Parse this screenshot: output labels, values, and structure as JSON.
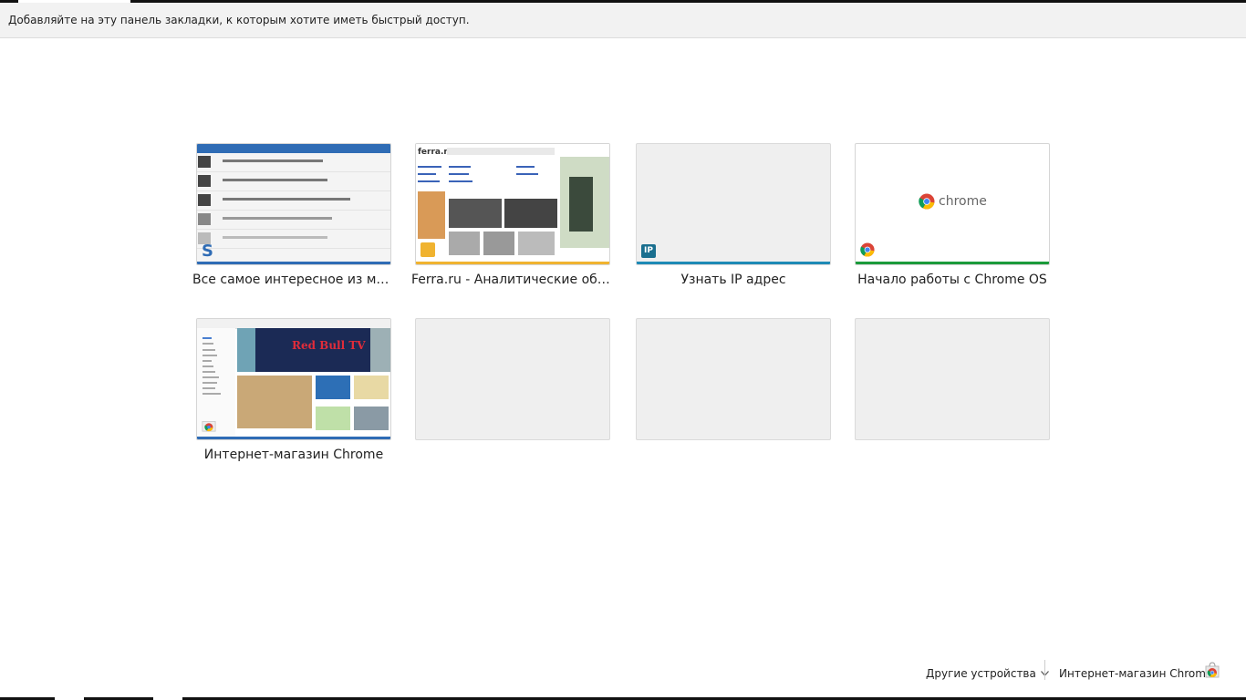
{
  "bookmarks_bar": {
    "hint": "Добавляйте на эту панель закладки, к которым хотите иметь быстрый доступ."
  },
  "tiles": [
    {
      "title": "Все самое интересное из ми...",
      "favicon": "3dnews-logo-icon",
      "accent": "#2f6cb5"
    },
    {
      "title": "Ferra.ru - Аналитические обз...",
      "favicon": "ferra-logo-icon",
      "accent": "#f0b330"
    },
    {
      "title": "Узнать IP адрес",
      "favicon": "ip-badge-icon",
      "favicon_text": "IP",
      "accent": "#1e8ab6"
    },
    {
      "title": "Начало работы с Chrome OS",
      "favicon": "chrome-icon",
      "accent": "#1a9a3a"
    },
    {
      "title": "Интернет-магазин Chrome",
      "favicon": "chrome-webstore-icon",
      "accent": "#2f6cb5"
    },
    {
      "title": ""
    },
    {
      "title": ""
    },
    {
      "title": ""
    }
  ],
  "thumbnails": {
    "ferra_logo": "ferra.ru",
    "chrome_word": "chrome",
    "redbull_text": "Red Bull TV"
  },
  "footer": {
    "other_devices": "Другие устройства",
    "webstore": "Интернет-магазин Chrome"
  }
}
